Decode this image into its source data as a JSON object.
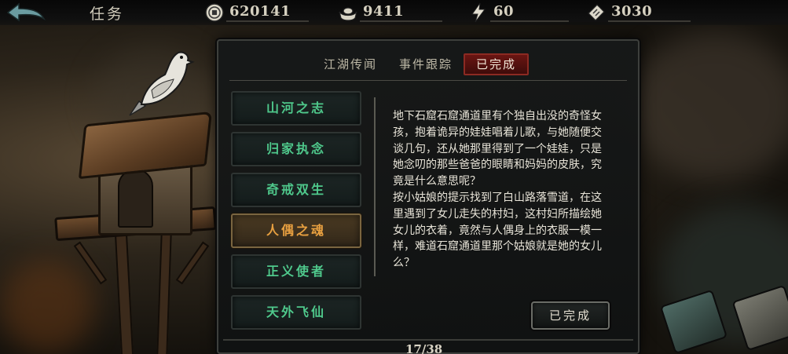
{
  "topbar": {
    "title": "任务",
    "resources": [
      {
        "name": "coin",
        "icon": "coin-icon",
        "value": "620141"
      },
      {
        "name": "silver-ingot",
        "icon": "ingot-icon",
        "value": "9411"
      },
      {
        "name": "energy",
        "icon": "lightning-icon",
        "value": "60"
      },
      {
        "name": "ticket",
        "icon": "ticket-icon",
        "value": "3030"
      }
    ]
  },
  "panel": {
    "tabs": [
      {
        "label": "江湖传闻",
        "active": false
      },
      {
        "label": "事件跟踪",
        "active": false
      },
      {
        "label": "已完成",
        "active": true
      }
    ],
    "chapters": [
      {
        "label": "山河之志",
        "selected": false
      },
      {
        "label": "归家执念",
        "selected": false
      },
      {
        "label": "奇戒双生",
        "selected": false
      },
      {
        "label": "人偶之魂",
        "selected": true
      },
      {
        "label": "正义使者",
        "selected": false
      },
      {
        "label": "天外飞仙",
        "selected": false
      }
    ],
    "description": {
      "paragraph1": "地下石窟石窟通道里有个独自出没的奇怪女孩，抱着诡异的娃娃唱着儿歌，与她随便交谈几句，还从她那里得到了一个娃娃，只是她念叨的那些爸爸的眼睛和妈妈的皮肤，究竟是什么意思呢？",
      "paragraph2": "按小姑娘的提示找到了白山路落雪道，在这里遇到了女儿走失的村妇，这村妇所描绘她女儿的衣着，竟然与人偶身上的衣服一模一样，难道石窟通道里那个姑娘就是她的女儿么？"
    },
    "done_button": "已完成",
    "page_counter": "17/38"
  },
  "colors": {
    "chapter_text": "#4fc98c",
    "selected_chapter_text": "#e8a040",
    "active_tab_bg": "#6a1512"
  }
}
